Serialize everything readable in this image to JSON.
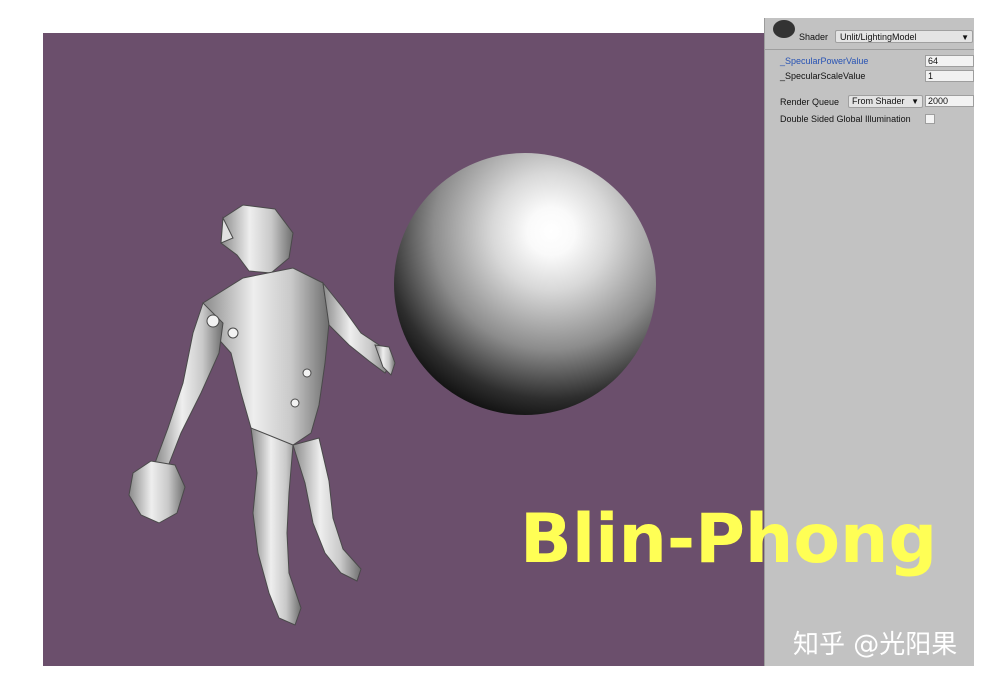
{
  "inspector": {
    "shader_label": "Shader",
    "shader_value": "Unlit/LightingModel",
    "properties": [
      {
        "label": "_SpecularPowerValue",
        "value": "64"
      },
      {
        "label": "_SpecularScaleValue",
        "value": "1"
      }
    ],
    "render_queue_label": "Render Queue",
    "render_queue_mode": "From Shader",
    "render_queue_value": "2000",
    "double_sided_gi_label": "Double Sided Global Illumination",
    "double_sided_gi_checked": false
  },
  "overlay": {
    "title": "Blin-Phong",
    "title_color": "#ffff55"
  },
  "watermark": "知乎 @光阳果",
  "colors": {
    "viewport_bg": "#6b4f6c",
    "inspector_bg": "#c2c2c2",
    "active_property": "#2853b4"
  },
  "icons": {
    "dropdown": "caret-down-icon"
  }
}
